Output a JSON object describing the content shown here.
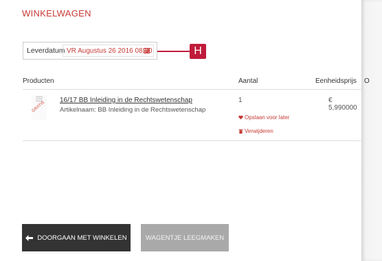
{
  "page": {
    "title": "WINKELWAGEN"
  },
  "delivery": {
    "label": "Leverdatum",
    "value": "VR Augustus 26 2016 08:30",
    "icon": "calendar-icon"
  },
  "annotation": {
    "badge": "H"
  },
  "table": {
    "headers": {
      "products": "Producten",
      "quantity": "Aantal",
      "unit_price": "Eenheidsprijs",
      "extra": "O"
    },
    "rows": [
      {
        "title": "16/17 BB Inleiding in de Rechtswetenschap",
        "subtitle": "Artikelnaam: BB Inleiding in de Rechtswetenschap",
        "quantity": "1",
        "unit_price": "€ 5,990000",
        "save_label": "Opslaan voor later",
        "remove_label": "Verwijderen"
      }
    ]
  },
  "buttons": {
    "continue": "DOORGAAN MET WINKELEN",
    "empty": "WAGENTJE LEEGMAKEN"
  },
  "colors": {
    "accent": "#c63a36",
    "callout": "#c01a3a",
    "dark_button": "#333333",
    "disabled_button": "#a9a9a9"
  }
}
